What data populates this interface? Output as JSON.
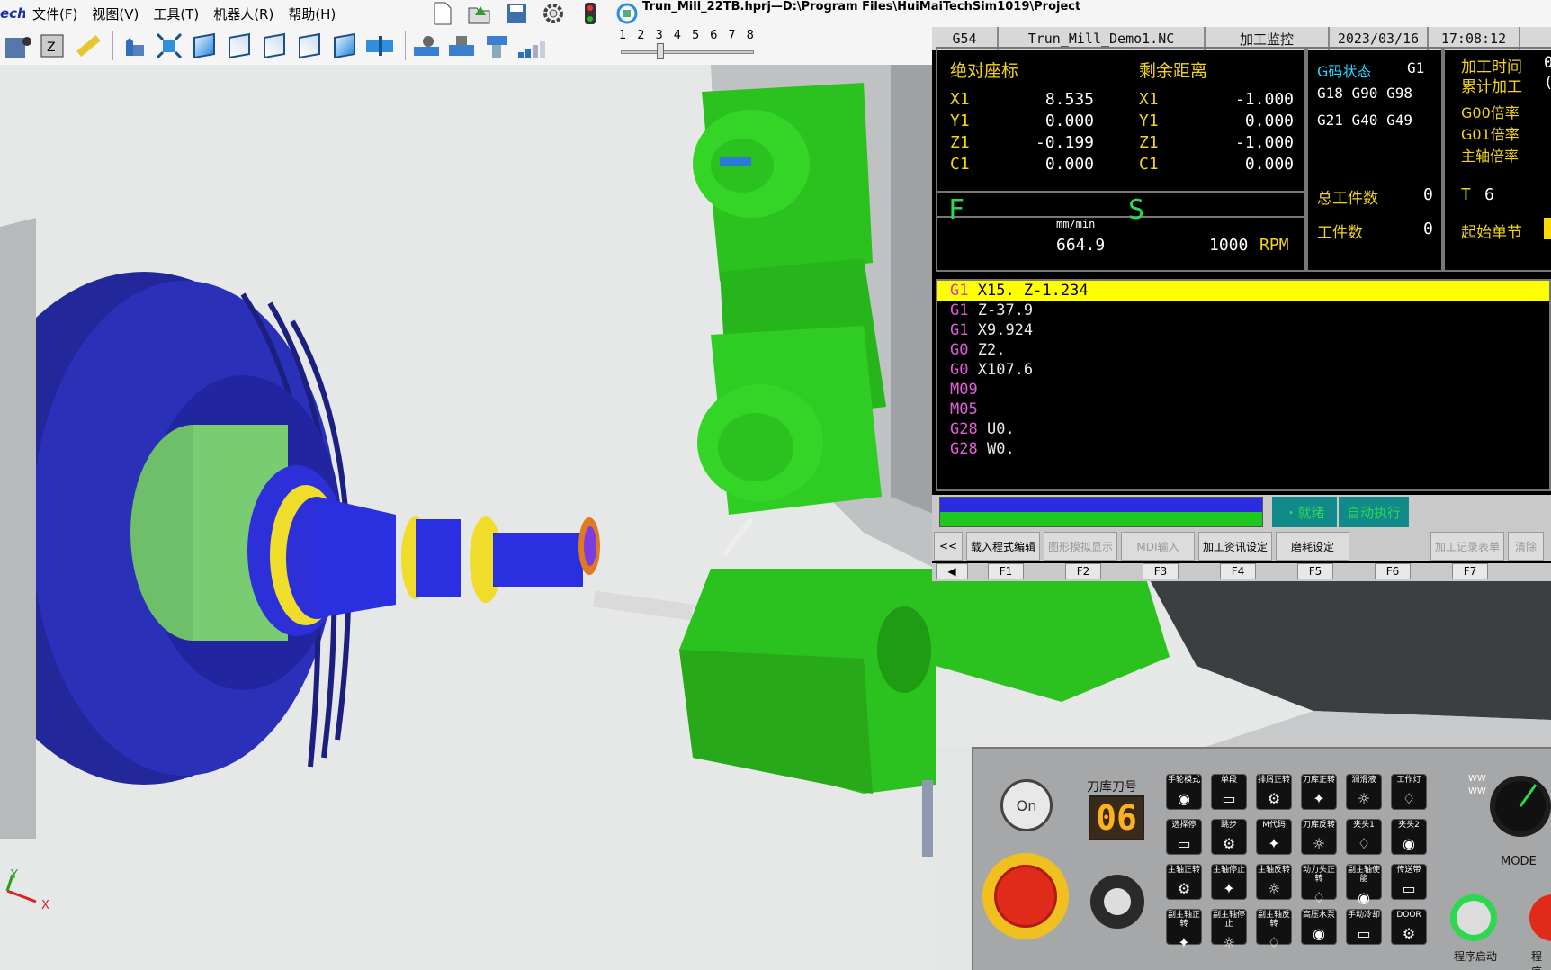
{
  "menubar": {
    "brand": "ech",
    "items": [
      "文件(F)",
      "视图(V)",
      "工具(T)",
      "机器人(R)",
      "帮助(H)"
    ],
    "title": "Trun_Mill_22TB.hprj—D:\\Program Files\\HuiMaiTechSim1019\\Project"
  },
  "speed": {
    "ticks": [
      "1",
      "2",
      "3",
      "4",
      "5",
      "6",
      "7",
      "8"
    ],
    "value": 3
  },
  "cnc": {
    "header": {
      "coord": "G54",
      "program": "Trun_Mill_Demo1.NC",
      "mode": "加工监控",
      "date": "2023/03/16",
      "time": "17:08:12"
    },
    "abs_title": "绝对座标",
    "rem_title": "剩余距离",
    "axes": [
      {
        "name": "X1",
        "abs": "8.535",
        "rem_name": "X1",
        "rem": "-1.000"
      },
      {
        "name": "Y1",
        "abs": "0.000",
        "rem_name": "Y1",
        "rem": "0.000"
      },
      {
        "name": "Z1",
        "abs": "-0.199",
        "rem_name": "Z1",
        "rem": "-1.000"
      },
      {
        "name": "C1",
        "abs": "0.000",
        "rem_name": "C1",
        "rem": "0.000"
      }
    ],
    "gstate_label": "G码状态",
    "gstate_value": "G1",
    "gcodes_row1": "G18 G90 G98",
    "gcodes_row2": "G21 G40 G49",
    "right_labels": [
      "加工时间",
      "累计加工",
      "G00倍率",
      "G01倍率",
      "主轴倍率"
    ],
    "right_vals": [
      "0",
      "("
    ],
    "feed_label": "F",
    "feed_unit": "mm/min",
    "feed_value": "664.9",
    "spindle_label": "S",
    "spindle_value": "1000",
    "spindle_unit": "RPM",
    "total_parts_label": "总工件数",
    "total_parts": "0",
    "parts_label": "工件数",
    "parts": "0",
    "tool_label": "T",
    "tool_value": "6",
    "start_block_label": "起始单节",
    "program_lines": [
      {
        "cmd": "G1",
        "args": "X15. Z-1.234"
      },
      {
        "cmd": "G1",
        "args": "Z-37.9"
      },
      {
        "cmd": "G1",
        "args": "X9.924"
      },
      {
        "cmd": "G0",
        "args": "Z2."
      },
      {
        "cmd": "G0",
        "args": "X107.6"
      },
      {
        "cmd": "M09",
        "args": ""
      },
      {
        "cmd": "M05",
        "args": ""
      },
      {
        "cmd": "G28",
        "args": "U0."
      },
      {
        "cmd": "G28",
        "args": "W0."
      }
    ],
    "status_ready": "・就绪",
    "status_auto": "自动执行",
    "fbuttons": [
      "<<",
      "载入程式编辑",
      "图形模拟显示",
      "MDI输入",
      "加工资讯设定",
      "磨耗设定",
      "",
      "加工记录表单",
      "清除"
    ],
    "flabels": [
      "◀",
      "F1",
      "F2",
      "F3",
      "F4",
      "F5",
      "F6",
      "F7"
    ]
  },
  "machine": {
    "on_label": "On",
    "tool_mag_label": "刀库刀号",
    "tool_mag_value": "06",
    "buttons": [
      [
        "手轮模式",
        "单段",
        "排屑正转",
        "刀库正转",
        "润滑液",
        "工作灯"
      ],
      [
        "选择停",
        "跳步",
        "M代码",
        "刀库反转",
        "夹头1",
        "夹头2"
      ],
      [
        "主轴正转",
        "主轴停止",
        "主轴反转",
        "动力头正转",
        "副主轴使能",
        "传送带"
      ],
      [
        "副主轴正转",
        "副主轴停止",
        "副主轴反转",
        "高压水泵",
        "手动冷却",
        "DOOR"
      ]
    ],
    "mode_label": "MODE",
    "start_label": "程序启动",
    "stop_label": "程序"
  },
  "axis_labels": {
    "y": "Y",
    "x": "X"
  }
}
